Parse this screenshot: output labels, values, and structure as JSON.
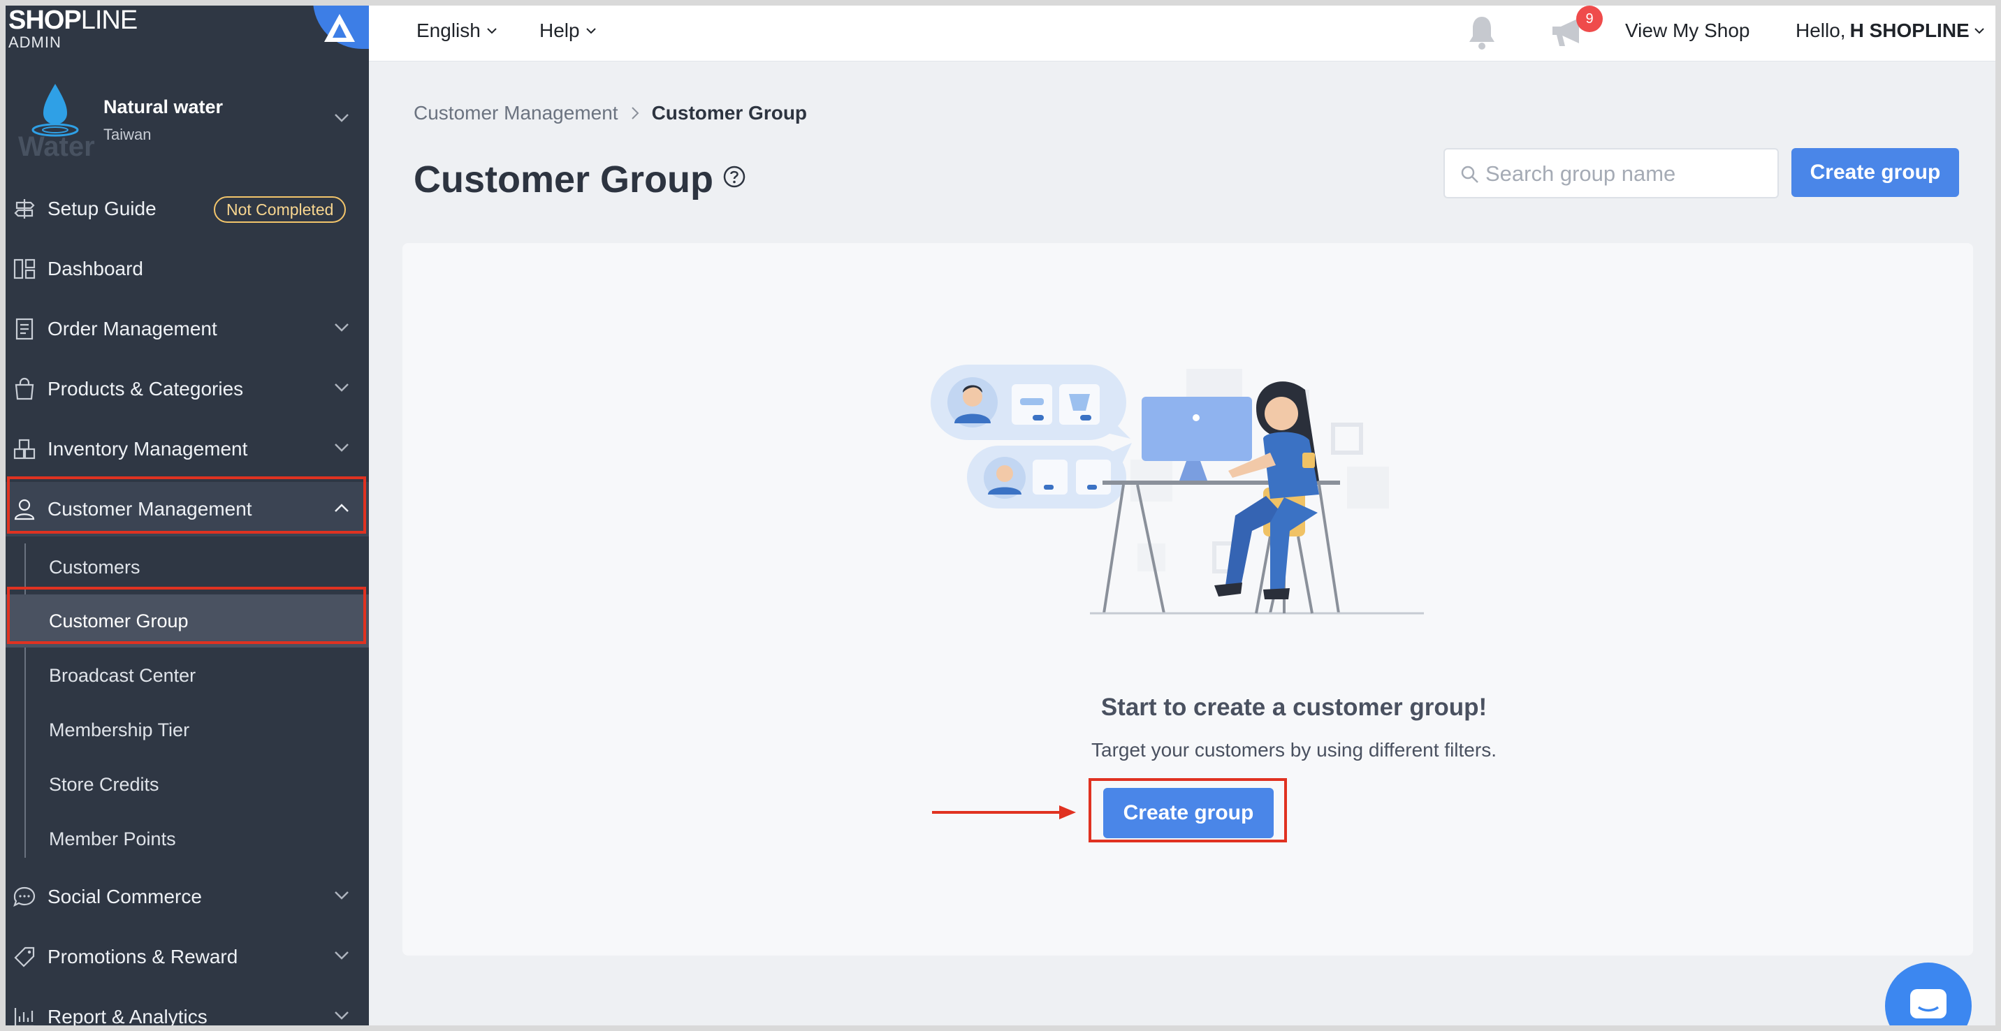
{
  "brand": {
    "logo_bold": "SHOP",
    "logo_thin": "LINE",
    "subtitle": "ADMIN"
  },
  "shop": {
    "name": "Natural water",
    "region": "Taiwan",
    "avatar_word": "Water"
  },
  "sidebar": {
    "items": [
      {
        "label": "Setup Guide",
        "badge": "Not Completed"
      },
      {
        "label": "Dashboard"
      },
      {
        "label": "Order Management"
      },
      {
        "label": "Products & Categories"
      },
      {
        "label": "Inventory Management"
      },
      {
        "label": "Customer Management"
      },
      {
        "label": "Social Commerce"
      },
      {
        "label": "Promotions & Reward"
      },
      {
        "label": "Report & Analytics"
      }
    ],
    "sub_items": [
      {
        "label": "Customers"
      },
      {
        "label": "Customer Group"
      },
      {
        "label": "Broadcast Center"
      },
      {
        "label": "Membership Tier"
      },
      {
        "label": "Store Credits"
      },
      {
        "label": "Member Points"
      }
    ]
  },
  "topbar": {
    "language": "English",
    "help": "Help",
    "notification_count": "9",
    "view_shop": "View My Shop",
    "greeting_prefix": "Hello,",
    "greeting_name": "H SHOPLINE"
  },
  "breadcrumb": {
    "parent": "Customer Management",
    "current": "Customer Group"
  },
  "page": {
    "title": "Customer Group",
    "search_placeholder": "Search group name",
    "create_button": "Create group"
  },
  "empty_state": {
    "title": "Start to create a customer group!",
    "description": "Target your customers by using different filters.",
    "button": "Create group"
  },
  "colors": {
    "sidebar_bg": "#2f3744",
    "primary": "#4a86e8",
    "highlight": "#e03221",
    "badge_border": "#f3c56b"
  }
}
